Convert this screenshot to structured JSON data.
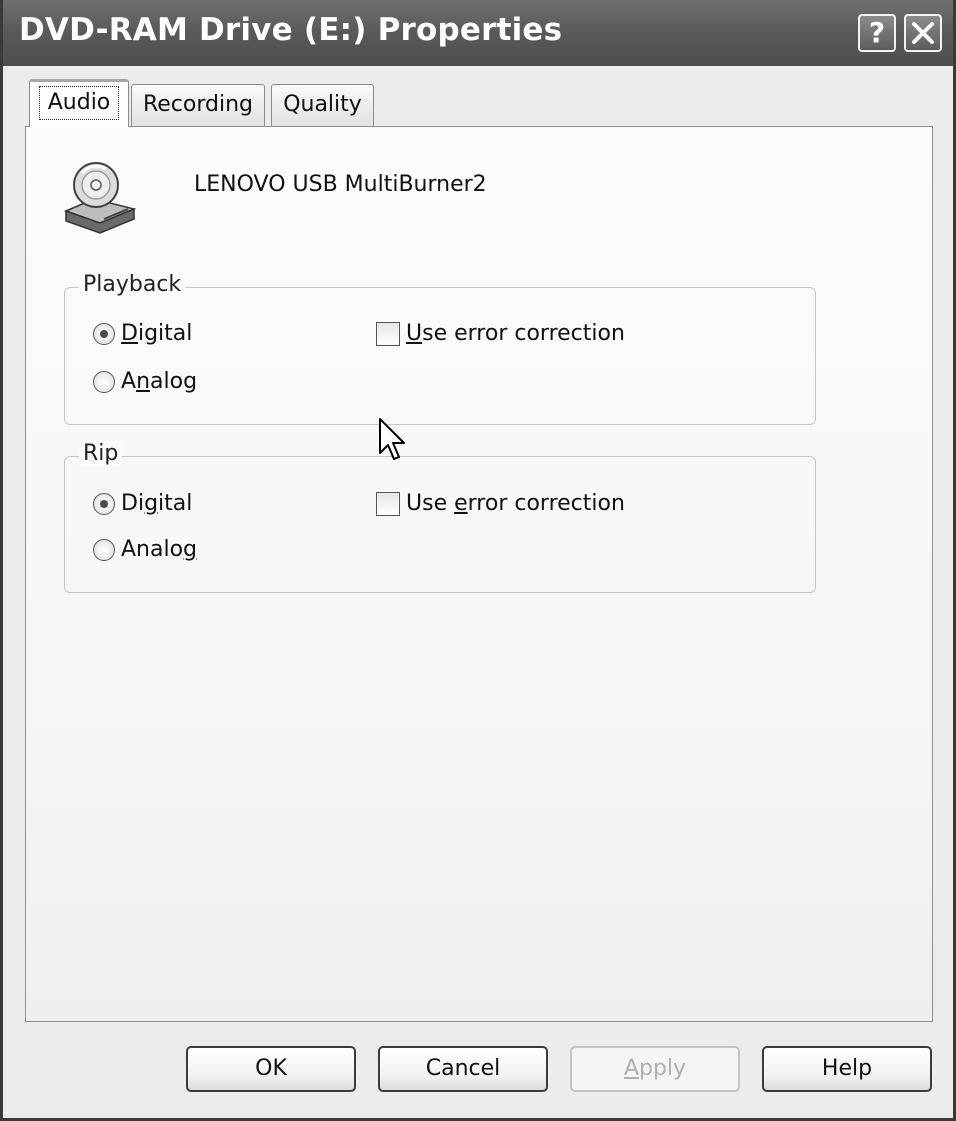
{
  "window": {
    "title": "DVD-RAM Drive (E:) Properties",
    "help_button": "?",
    "close_button": "✕"
  },
  "tabs": [
    {
      "label": "Audio",
      "active": true
    },
    {
      "label": "Recording",
      "active": false
    },
    {
      "label": "Quality",
      "active": false
    }
  ],
  "device": {
    "name": "LENOVO  USB MultiBurner2",
    "icon": "cd-drive-icon"
  },
  "playback": {
    "legend": "Playback",
    "digital": {
      "pre": "",
      "key": "D",
      "post": "igital",
      "selected": true
    },
    "analog": {
      "pre": "A",
      "key": "n",
      "post": "alog",
      "selected": false
    },
    "error_correction": {
      "pre": "",
      "key": "U",
      "post": "se error correction",
      "checked": false
    }
  },
  "rip": {
    "legend": "Rip",
    "digital": {
      "pre": "Di",
      "key": "g",
      "post": "ital",
      "selected": true
    },
    "analog": {
      "pre": "Analo",
      "key": "g",
      "post": "",
      "selected": false
    },
    "error_correction": {
      "pre": "Use ",
      "key": "e",
      "post": "rror correction",
      "checked": false
    }
  },
  "buttons": {
    "ok": "OK",
    "cancel": "Cancel",
    "apply_key": "A",
    "apply_rest": "pply",
    "help": "Help"
  }
}
